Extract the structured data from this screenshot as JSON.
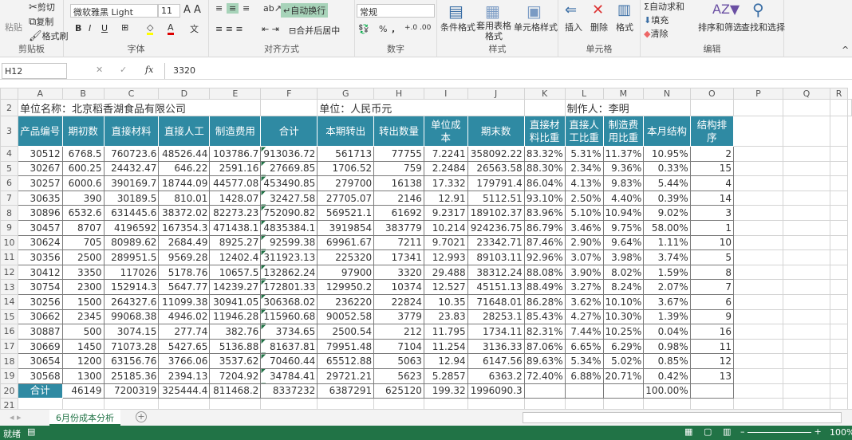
{
  "ribbon": {
    "clipboard": {
      "paste": "粘贴",
      "cut": "剪切",
      "copy": "复制",
      "format_painter": "格式刷",
      "label": "剪贴板"
    },
    "font": {
      "name": "微软雅黑 Light",
      "size": "11",
      "bold": "B",
      "italic": "I",
      "underline": "U",
      "label": "字体"
    },
    "alignment": {
      "wrap": "自动换行",
      "merge": "合并后居中",
      "label": "对齐方式"
    },
    "number": {
      "format": "常规",
      "percent": "%",
      "comma": ",",
      "label": "数字"
    },
    "styles": {
      "conditional": "条件格式",
      "table_format": "套用表格格式",
      "cell_styles": "单元格样式",
      "label": "样式"
    },
    "cells": {
      "insert": "插入",
      "delete": "删除",
      "format": "格式",
      "label": "单元格"
    },
    "editing": {
      "autosum": "自动求和",
      "fill": "填充",
      "clear": "清除",
      "sort": "排序和筛选",
      "find": "查找和选择",
      "label": "编辑"
    }
  },
  "formula_bar": {
    "name_box": "H12",
    "fx": "fx",
    "value": "3320"
  },
  "columns": [
    "A",
    "B",
    "C",
    "D",
    "E",
    "F",
    "G",
    "H",
    "I",
    "J",
    "K",
    "L",
    "M",
    "N",
    "O",
    "P",
    "Q",
    "R"
  ],
  "sheet": {
    "company": "单位名称：北京稻香湖食品有限公司",
    "unit": "单位：人民币元",
    "maker": "制作人：李明",
    "headers": [
      "产品编号",
      "期初数",
      "直接材料",
      "直接人工",
      "制造费用",
      "合计",
      "本期转出",
      "转出数量",
      "单位成本",
      "期末数",
      "直接材料比重",
      "直接人工比重",
      "制造费用比重",
      "本月结构",
      "结构排序"
    ],
    "rows": [
      [
        "30512",
        "6768.5",
        "760723.6",
        "48526.44",
        "103786.7",
        "913036.72",
        "561713",
        "77755",
        "7.2241",
        "358092.22",
        "83.32%",
        "5.31%",
        "11.37%",
        "10.95%",
        "2"
      ],
      [
        "30267",
        "600.25",
        "24432.47",
        "646.22",
        "2591.16",
        "27669.85",
        "1706.52",
        "759",
        "2.2484",
        "26563.58",
        "88.30%",
        "2.34%",
        "9.36%",
        "0.33%",
        "15"
      ],
      [
        "30257",
        "6000.6",
        "390169.7",
        "18744.09",
        "44577.08",
        "453490.85",
        "279700",
        "16138",
        "17.332",
        "179791.4",
        "86.04%",
        "4.13%",
        "9.83%",
        "5.44%",
        "4"
      ],
      [
        "30635",
        "390",
        "30189.5",
        "810.01",
        "1428.07",
        "32427.58",
        "27705.07",
        "2146",
        "12.91",
        "5112.51",
        "93.10%",
        "2.50%",
        "4.40%",
        "0.39%",
        "14"
      ],
      [
        "30896",
        "6532.6",
        "631445.6",
        "38372.02",
        "82273.23",
        "752090.82",
        "569521.1",
        "61692",
        "9.2317",
        "189102.37",
        "83.96%",
        "5.10%",
        "10.94%",
        "9.02%",
        "3"
      ],
      [
        "30457",
        "8707",
        "4196592",
        "167354.3",
        "471438.1",
        "4835384.1",
        "3919854",
        "383779",
        "10.214",
        "924236.75",
        "86.79%",
        "3.46%",
        "9.75%",
        "58.00%",
        "1"
      ],
      [
        "30624",
        "705",
        "80989.62",
        "2684.49",
        "8925.27",
        "92599.38",
        "69961.67",
        "7211",
        "9.7021",
        "23342.71",
        "87.46%",
        "2.90%",
        "9.64%",
        "1.11%",
        "10"
      ],
      [
        "30356",
        "2500",
        "289951.5",
        "9569.28",
        "12402.4",
        "311923.13",
        "225320",
        "17341",
        "12.993",
        "89103.11",
        "92.96%",
        "3.07%",
        "3.98%",
        "3.74%",
        "5"
      ],
      [
        "30412",
        "3350",
        "117026",
        "5178.76",
        "10657.5",
        "132862.24",
        "97900",
        "3320",
        "29.488",
        "38312.24",
        "88.08%",
        "3.90%",
        "8.02%",
        "1.59%",
        "8"
      ],
      [
        "30754",
        "2300",
        "152914.3",
        "5647.77",
        "14239.27",
        "172801.33",
        "129950.2",
        "10374",
        "12.527",
        "45151.13",
        "88.49%",
        "3.27%",
        "8.24%",
        "2.07%",
        "7"
      ],
      [
        "30256",
        "1500",
        "264327.6",
        "11099.38",
        "30941.05",
        "306368.02",
        "236220",
        "22824",
        "10.35",
        "71648.01",
        "86.28%",
        "3.62%",
        "10.10%",
        "3.67%",
        "6"
      ],
      [
        "30662",
        "2345",
        "99068.38",
        "4946.02",
        "11946.28",
        "115960.68",
        "90052.58",
        "3779",
        "23.83",
        "28253.1",
        "85.43%",
        "4.27%",
        "10.30%",
        "1.39%",
        "9"
      ],
      [
        "30887",
        "500",
        "3074.15",
        "277.74",
        "382.76",
        "3734.65",
        "2500.54",
        "212",
        "11.795",
        "1734.11",
        "82.31%",
        "7.44%",
        "10.25%",
        "0.04%",
        "16"
      ],
      [
        "30669",
        "1450",
        "71073.28",
        "5427.65",
        "5136.88",
        "81637.81",
        "79951.48",
        "7104",
        "11.254",
        "3136.33",
        "87.06%",
        "6.65%",
        "6.29%",
        "0.98%",
        "11"
      ],
      [
        "30654",
        "1200",
        "63156.76",
        "3766.06",
        "3537.62",
        "70460.44",
        "65512.88",
        "5063",
        "12.94",
        "6147.56",
        "89.63%",
        "5.34%",
        "5.02%",
        "0.85%",
        "12"
      ],
      [
        "30568",
        "1300",
        "25185.36",
        "2394.13",
        "7204.92",
        "34784.41",
        "29721.21",
        "5623",
        "5.2857",
        "6363.2",
        "72.40%",
        "6.88%",
        "20.71%",
        "0.42%",
        "13"
      ],
      [
        "合计",
        "46149",
        "7200319",
        "325444.4",
        "811468.2",
        "8337232",
        "6387291",
        "625120",
        "199.32",
        "1996090.3",
        "",
        "",
        "",
        "100.00%",
        ""
      ]
    ]
  },
  "tabs": {
    "active": "6月份成本分析",
    "add": "+"
  },
  "status": {
    "ready": "就绪",
    "zoom": "100%"
  },
  "colors": {
    "header_fill": "#2f8aa3",
    "status_bar": "#217346"
  }
}
